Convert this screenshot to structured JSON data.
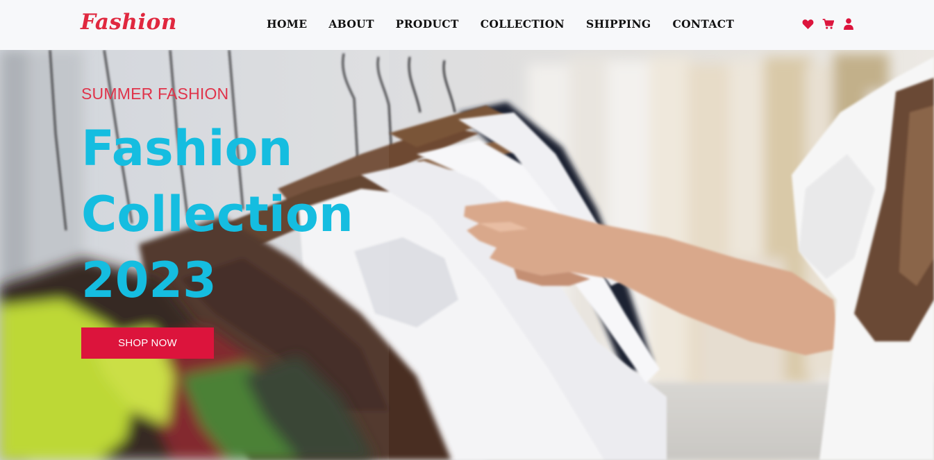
{
  "header": {
    "logo": "Fashion",
    "nav": [
      "HOME",
      "ABOUT",
      "PRODUCT",
      "COLLECTION",
      "SHIPPING",
      "CONTACT"
    ],
    "icons": [
      "heart-icon",
      "cart-icon",
      "user-icon"
    ]
  },
  "hero": {
    "subtitle": "SUMMER FASHION",
    "title_line1": "Fashion",
    "title_line2": "Collection",
    "title_line3": "2023",
    "button_label": "SHOP NOW"
  },
  "colors": {
    "accent": "#dc143c",
    "logo": "#e0283f",
    "title": "#15bde0",
    "nav_bg": "#f7f8fa"
  }
}
